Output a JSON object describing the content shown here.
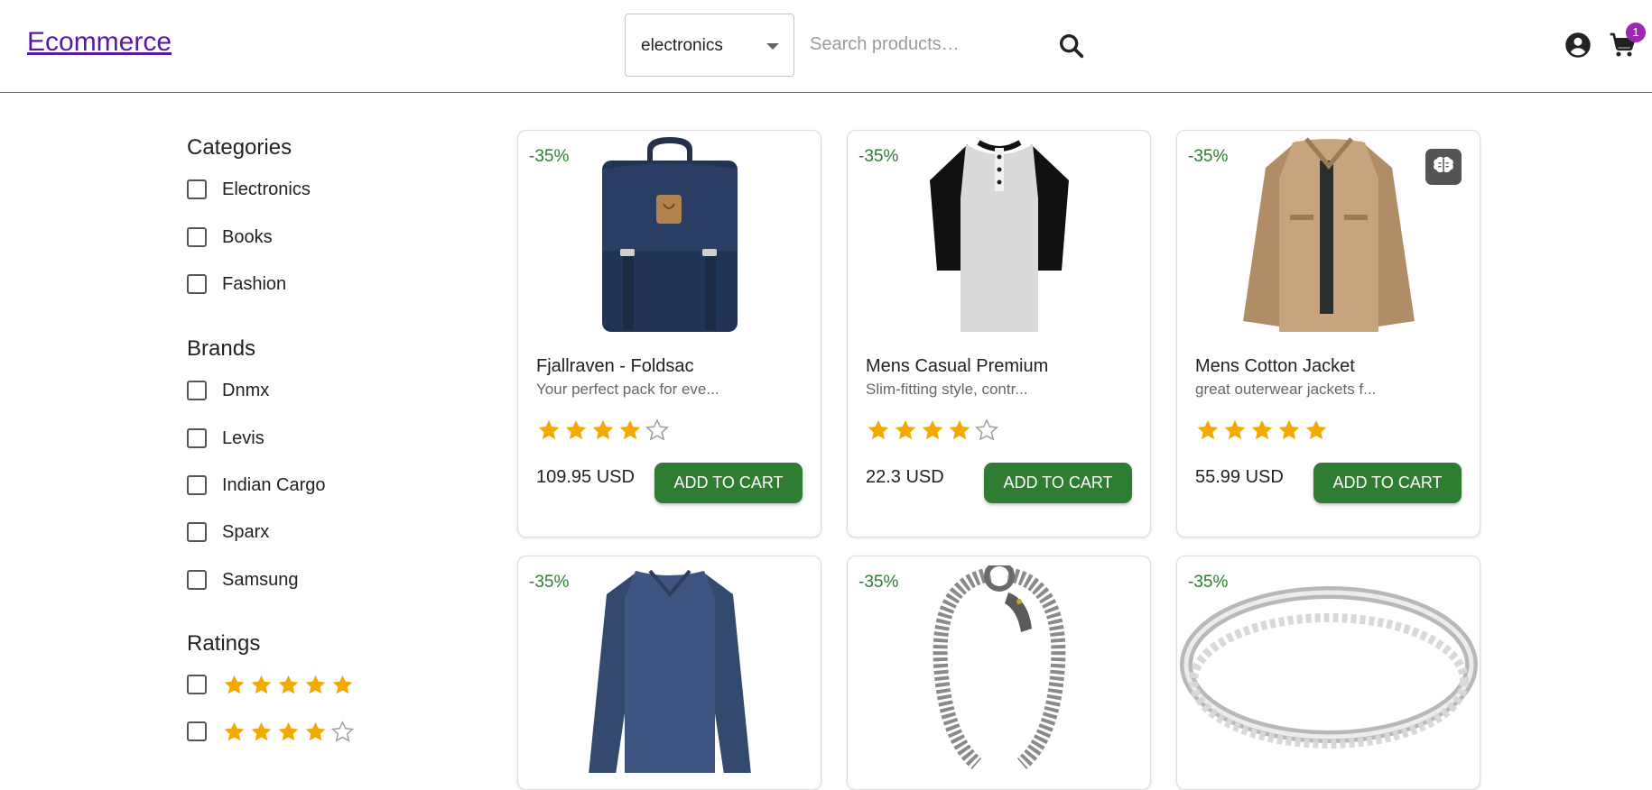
{
  "header": {
    "logo": "Ecommerce",
    "category_select": {
      "value": "electronics"
    },
    "search": {
      "placeholder": "Search products…"
    },
    "cart_count": "1"
  },
  "sidebar": {
    "categories": {
      "title": "Categories",
      "items": [
        "Electronics",
        "Books",
        "Fashion"
      ]
    },
    "brands": {
      "title": "Brands",
      "items": [
        "Dnmx",
        "Levis",
        "Indian Cargo",
        "Sparx",
        "Samsung"
      ]
    },
    "ratings": {
      "title": "Ratings",
      "items": [
        5,
        4
      ]
    }
  },
  "products": [
    {
      "discount": "-35%",
      "title": "Fjallraven - Foldsac",
      "description": "Your perfect pack for eve...",
      "rating": 4,
      "price": "109.95 USD",
      "button": "ADD TO CART",
      "image": "backpack"
    },
    {
      "discount": "-35%",
      "title": "Mens Casual Premium",
      "description": "Slim-fitting style, contr...",
      "rating": 4,
      "price": "22.3 USD",
      "button": "ADD TO CART",
      "image": "raglan-tshirt"
    },
    {
      "discount": "-35%",
      "title": "Mens Cotton Jacket",
      "description": "great outerwear jackets f...",
      "rating": 5,
      "price": "55.99 USD",
      "button": "ADD TO CART",
      "image": "cotton-jacket",
      "ai_icon": "brain-icon"
    },
    {
      "discount": "-35%",
      "image": "long-sleeve-shirt"
    },
    {
      "discount": "-35%",
      "image": "dragon-bracelet"
    },
    {
      "discount": "-35%",
      "image": "silver-ring"
    }
  ],
  "colors": {
    "accent": "#2e7d32",
    "star": "#f4a900",
    "badge": "#9c27b0",
    "logo": "#5a1aa0"
  }
}
